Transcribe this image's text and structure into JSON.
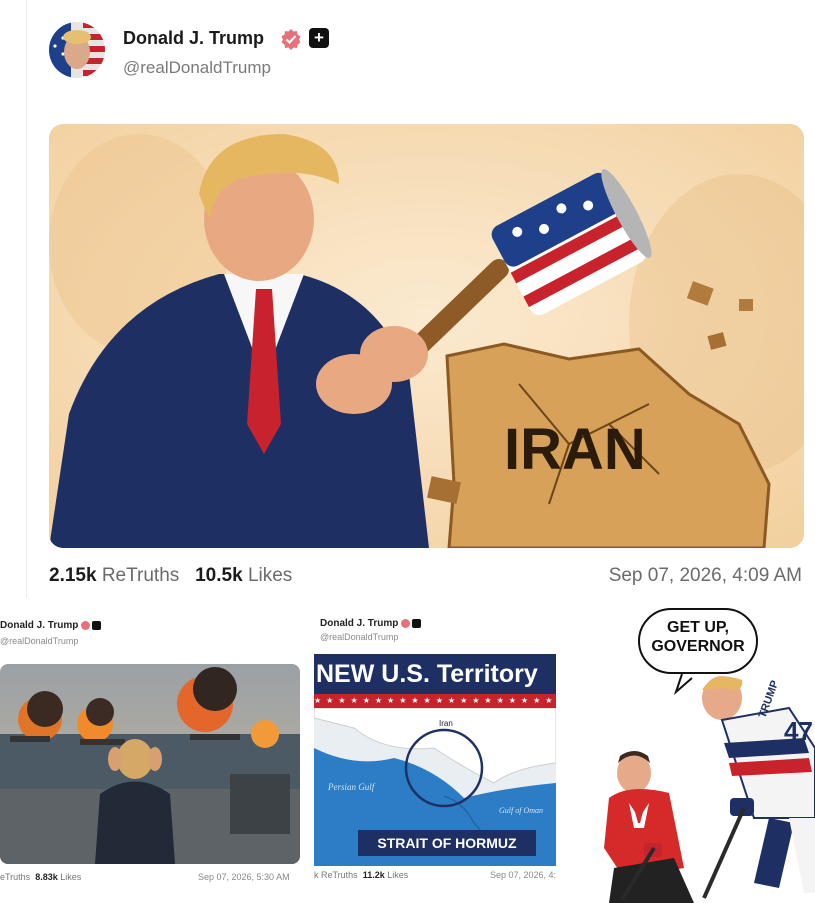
{
  "post": {
    "display_name": "Donald J. Trump",
    "handle": "@realDonaldTrump",
    "image_text": "IRAN",
    "retruths_count": "2.15k",
    "retruths_label": "ReTruths",
    "likes_count": "10.5k",
    "likes_label": "Likes",
    "timestamp": "Sep 07, 2026, 4:09 AM"
  },
  "mini1": {
    "display_name": "Donald J. Trump",
    "handle": "@realDonaldTrump",
    "retruths_label": "eTruths",
    "likes_count": "8.83k",
    "likes_label": "Likes",
    "timestamp": "Sep 07, 2026, 5:30 AM"
  },
  "mini2": {
    "display_name": "Donald J. Trump",
    "handle": "@realDonaldTrump",
    "headline": "NEW U.S. Territory",
    "map_label_iran": "Iran",
    "map_label_gulf": "Persian Gulf",
    "map_label_oman": "Gulf of Oman",
    "banner": "STRAIT OF HORMUZ",
    "retruths_label": "k ReTruths",
    "likes_count": "11.2k",
    "likes_label": "Likes",
    "timestamp": "Sep 07, 2026, 4:0"
  },
  "mini3": {
    "speech": "GET UP, GOVERNOR",
    "jersey_name": "TRUMP",
    "jersey_number": "47",
    "stick_text": "TRUMP"
  },
  "icons": {
    "verified": "verified-badge-icon",
    "plus": "plus-icon"
  },
  "colors": {
    "verified": "#e8707a",
    "stamp_gray": "#6b6b6b",
    "navy": "#1e2f64",
    "red": "#c8232c"
  }
}
